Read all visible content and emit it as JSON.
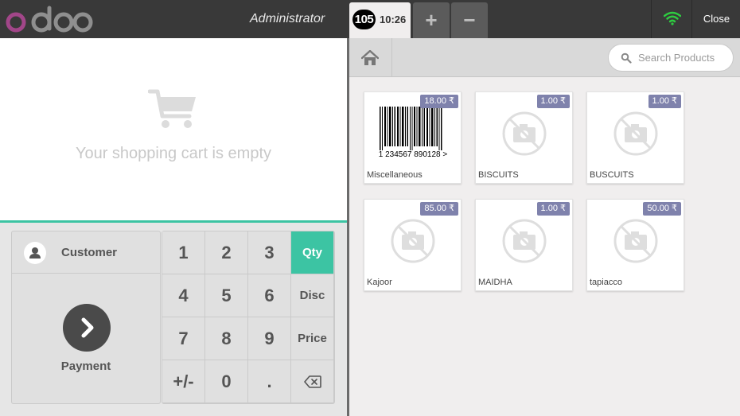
{
  "header": {
    "logo_text": "odoo",
    "user_name": "Administrator",
    "order": {
      "number": "105",
      "time": "10:26"
    },
    "add_order_label": "+",
    "remove_order_label": "−",
    "close_label": "Close",
    "wifi_color": "#2ecc40"
  },
  "cart": {
    "empty_text": "Your shopping cart is empty",
    "accent_color": "#3cc4a3"
  },
  "control": {
    "customer_label": "Customer",
    "payment_label": "Payment"
  },
  "numpad": {
    "keys": [
      "1",
      "2",
      "3",
      "Qty",
      "4",
      "5",
      "6",
      "Disc",
      "7",
      "8",
      "9",
      "Price",
      "+/-",
      "0",
      "."
    ],
    "selected_mode": "Qty"
  },
  "search": {
    "placeholder": "Search Products"
  },
  "products": [
    {
      "name": "Miscellaneous",
      "price": "18.00 ₹",
      "image": "barcode",
      "barcode_text": "1 234567 890128 >"
    },
    {
      "name": "BISCUITS",
      "price": "1.00 ₹",
      "image": "no-photo"
    },
    {
      "name": "BUSCUITS",
      "price": "1.00 ₹",
      "image": "no-photo"
    },
    {
      "name": "Kajoor",
      "price": "85.00 ₹",
      "image": "no-photo"
    },
    {
      "name": "MAIDHA",
      "price": "1.00 ₹",
      "image": "no-photo"
    },
    {
      "name": "tapiacco",
      "price": "50.00 ₹",
      "image": "no-photo"
    }
  ]
}
